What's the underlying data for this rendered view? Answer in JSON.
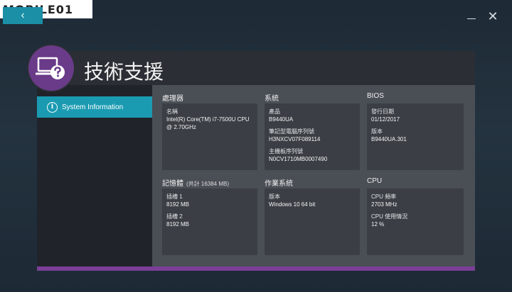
{
  "watermark": "MOBILE01",
  "nav": {
    "back_glyph": "‹",
    "close_glyph": "✕"
  },
  "page": {
    "title": "技術支援"
  },
  "sidebar": {
    "items": [
      {
        "label": "System Information",
        "icon": "info-icon"
      }
    ]
  },
  "sections": {
    "cpu_info": {
      "title": "處理器",
      "fields": [
        {
          "label": "名稱",
          "value": "Intel(R) Core(TM) i7-7500U CPU @ 2.70GHz"
        }
      ]
    },
    "system": {
      "title": "系統",
      "fields": [
        {
          "label": "產品",
          "value": "B9440UA"
        },
        {
          "label": "筆記型電腦序列號",
          "value": "H3NXCV07F089114"
        },
        {
          "label": "主機板序列號",
          "value": "N0CV1710MB0007490"
        }
      ]
    },
    "bios": {
      "title": "BIOS",
      "fields": [
        {
          "label": "發行日期",
          "value": "01/12/2017"
        },
        {
          "label": "版本",
          "value": "B9440UA.301"
        }
      ]
    },
    "memory": {
      "title": "記憶體",
      "subtitle": "(共計 16384 MB)",
      "fields": [
        {
          "label": "插槽 1",
          "value": "8192 MB"
        },
        {
          "label": "插槽 2",
          "value": "8192 MB"
        }
      ]
    },
    "os": {
      "title": "作業系統",
      "fields": [
        {
          "label": "版本",
          "value": "Windows 10 64 bit"
        }
      ]
    },
    "cpu": {
      "title": "CPU",
      "fields": [
        {
          "label": "CPU 頻率",
          "value": "2703 MHz"
        },
        {
          "label": "CPU 使用情況",
          "value": "12 %"
        }
      ]
    }
  },
  "colors": {
    "accent": "#1b9bb2",
    "brand": "#7b3f98"
  }
}
